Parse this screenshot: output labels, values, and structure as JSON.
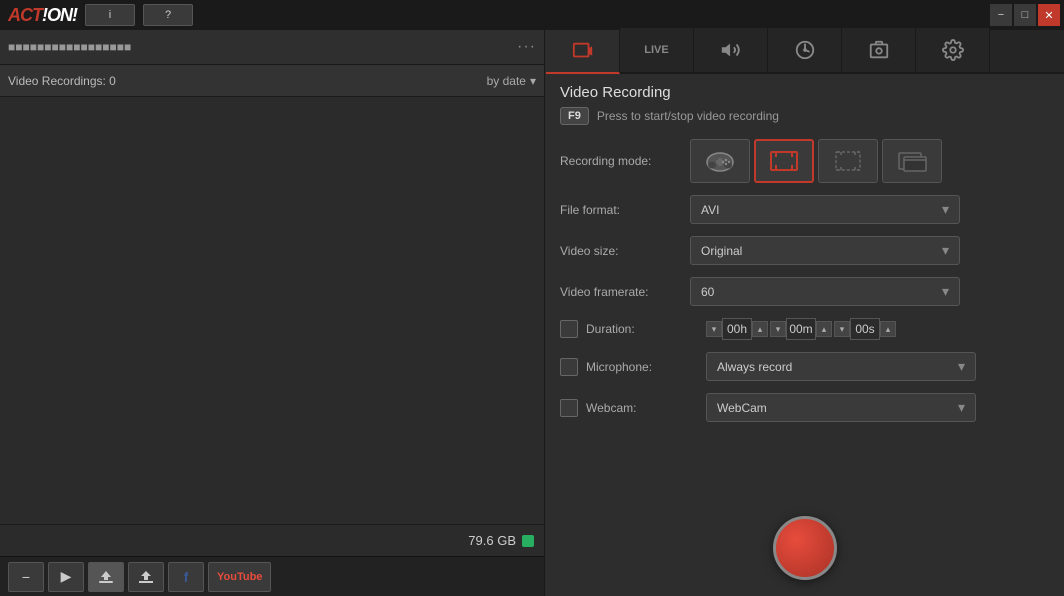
{
  "window": {
    "minimize_label": "−",
    "maximize_label": "□",
    "close_label": "✕"
  },
  "app": {
    "logo_text": "ACT!ON!",
    "info_btn": "i",
    "help_btn": "?",
    "left_panel_title": "■■■■■■■■■■■■■■■■■",
    "more_label": "···",
    "recordings_label": "Video Recordings: 0",
    "sort_label": "by date",
    "storage_label": "79.6 GB"
  },
  "toolbar": {
    "minus_label": "−",
    "play_label": "▶",
    "upload_label": "↑",
    "share_label": "↑",
    "facebook_label": "f",
    "youtube_label": "YouTube"
  },
  "tabs": [
    {
      "id": "video",
      "label": "video",
      "active": true
    },
    {
      "id": "live",
      "label": "LIVE",
      "active": false
    },
    {
      "id": "audio",
      "label": "audio",
      "active": false
    },
    {
      "id": "benchmark",
      "label": "bench",
      "active": false
    },
    {
      "id": "screenshot",
      "label": "screenshot",
      "active": false
    },
    {
      "id": "settings",
      "label": "settings",
      "active": false
    }
  ],
  "video_recording": {
    "section_title": "Video Recording",
    "shortcut_key": "F9",
    "shortcut_text": "Press to start/stop video recording",
    "recording_mode_label": "Recording mode:",
    "modes": [
      {
        "id": "gamepad",
        "label": "gamepad",
        "active": false
      },
      {
        "id": "fullscreen",
        "label": "fullscreen",
        "active": true
      },
      {
        "id": "region",
        "label": "region",
        "active": false
      },
      {
        "id": "window",
        "label": "window",
        "active": false
      }
    ],
    "file_format_label": "File format:",
    "file_format_value": "AVI",
    "video_size_label": "Video size:",
    "video_size_value": "Original",
    "video_framerate_label": "Video framerate:",
    "video_framerate_value": "60",
    "duration_label": "Duration:",
    "duration_hours": "00h",
    "duration_minutes": "00m",
    "duration_seconds": "00s",
    "microphone_label": "Microphone:",
    "microphone_value": "Always record",
    "webcam_label": "Webcam:",
    "webcam_value": "WebCam"
  }
}
